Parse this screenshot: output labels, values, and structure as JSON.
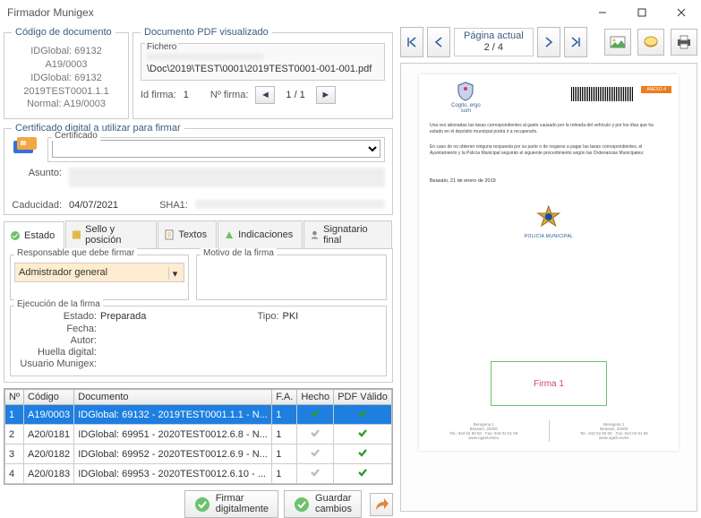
{
  "window": {
    "title": "Firmador Munigex"
  },
  "codigo": {
    "legend": "Código de documento",
    "lines": [
      "IDGlobal: 69132",
      "A19/0003",
      "IDGlobal: 69132",
      "2019TEST0001.1.1",
      "Normal: A19/0003"
    ]
  },
  "pdfvis": {
    "legend": "Documento PDF visualizado",
    "file_legend": "Fichero",
    "path_tail": "\\Doc\\2019\\TEST\\0001\\2019TEST0001-001-001.pdf",
    "id_firma_label": "Id firma:",
    "id_firma": "1",
    "n_firma_label": "Nº firma:",
    "n_firma": "1 / 1"
  },
  "cert": {
    "legend": "Certificado digital a utilizar para firmar",
    "box_legend": "Certificado",
    "asunto_label": "Asunto:",
    "caducidad_label": "Caducidad:",
    "caducidad": "04/07/2021",
    "sha1_label": "SHA1:"
  },
  "tabs": {
    "items": [
      "Estado",
      "Sello y posición",
      "Textos",
      "Indicaciones",
      "Signatario final"
    ],
    "active": 0
  },
  "estado": {
    "resp_legend": "Responsable que debe firmar",
    "resp_value": "Admistrador general",
    "motivo_legend": "Motivo de la firma",
    "motivo_value": "",
    "exec_legend": "Ejecución de la firma",
    "rows": {
      "estado_k": "Estado:",
      "estado_v": "Preparada",
      "tipo_k": "Tipo:",
      "tipo_v": "PKI",
      "fecha_k": "Fecha:",
      "autor_k": "Autor:",
      "huella_k": "Huella digital:",
      "usuario_k": "Usuario Munigex:"
    }
  },
  "grid": {
    "headers": [
      "Nº",
      "Código",
      "Documento",
      "F.A.",
      "Hecho",
      "PDF Válido"
    ],
    "rows": [
      {
        "n": "1",
        "codigo": "A19/0003",
        "doc": "IDGlobal: 69132 - 2019TEST0001.1.1 - N...",
        "fa": "1",
        "hecho": true,
        "valido": true,
        "selected": true
      },
      {
        "n": "2",
        "codigo": "A20/0181",
        "doc": "IDGlobal: 69951 - 2020TEST0012.6.8 - N...",
        "fa": "1",
        "hecho": false,
        "valido": true,
        "selected": false
      },
      {
        "n": "3",
        "codigo": "A20/0182",
        "doc": "IDGlobal: 69952 - 2020TEST0012.6.9 - N...",
        "fa": "1",
        "hecho": false,
        "valido": true,
        "selected": false
      },
      {
        "n": "4",
        "codigo": "A20/0183",
        "doc": "IDGlobal: 69953 - 2020TEST0012.6.10 - ...",
        "fa": "1",
        "hecho": false,
        "valido": true,
        "selected": false
      }
    ]
  },
  "actions": {
    "firmar": "Firmar\ndigitalmente",
    "guardar": "Guardar\ncambios"
  },
  "pager": {
    "label": "Página actual",
    "value": "2 / 4"
  },
  "preview": {
    "motto": "Cogito, ergo\nsum",
    "anexo": "ANEXO 4",
    "p1": "Una vez abonadas las tasas correspondientes al gasto causado por la retirada del vehículo y por los días que ha estado en el depósito municipal podrá ir a recuperarlo.",
    "p2": "En caso de no obtener ninguna respuesta por su parte o de negarse a pagar las tasas correspondientes, el Ayuntamiento y la Policía Municipal seguirán el siguiente procedimiento según las Ordenanzas Municipales:",
    "fecha": "Beasáin, 21 de enero de 2019",
    "badge_label": "POLICÍA MUNICIPAL",
    "firma": "Firma 1",
    "footer": [
      {
        "l1": "Beregena 1",
        "l2": "Beasain, 20200",
        "l3": "Tel.: 943 02 80 50 · Fax: 943 02 51 59",
        "l4": "www.ogasl.es/eu"
      },
      {
        "l1": "Beregena 1",
        "l2": "Beasain, 20200",
        "l3": "Tel.: 943 02 80 50 · Fax: 943 02 51 59",
        "l4": "www.ogasl.es/es"
      }
    ]
  }
}
